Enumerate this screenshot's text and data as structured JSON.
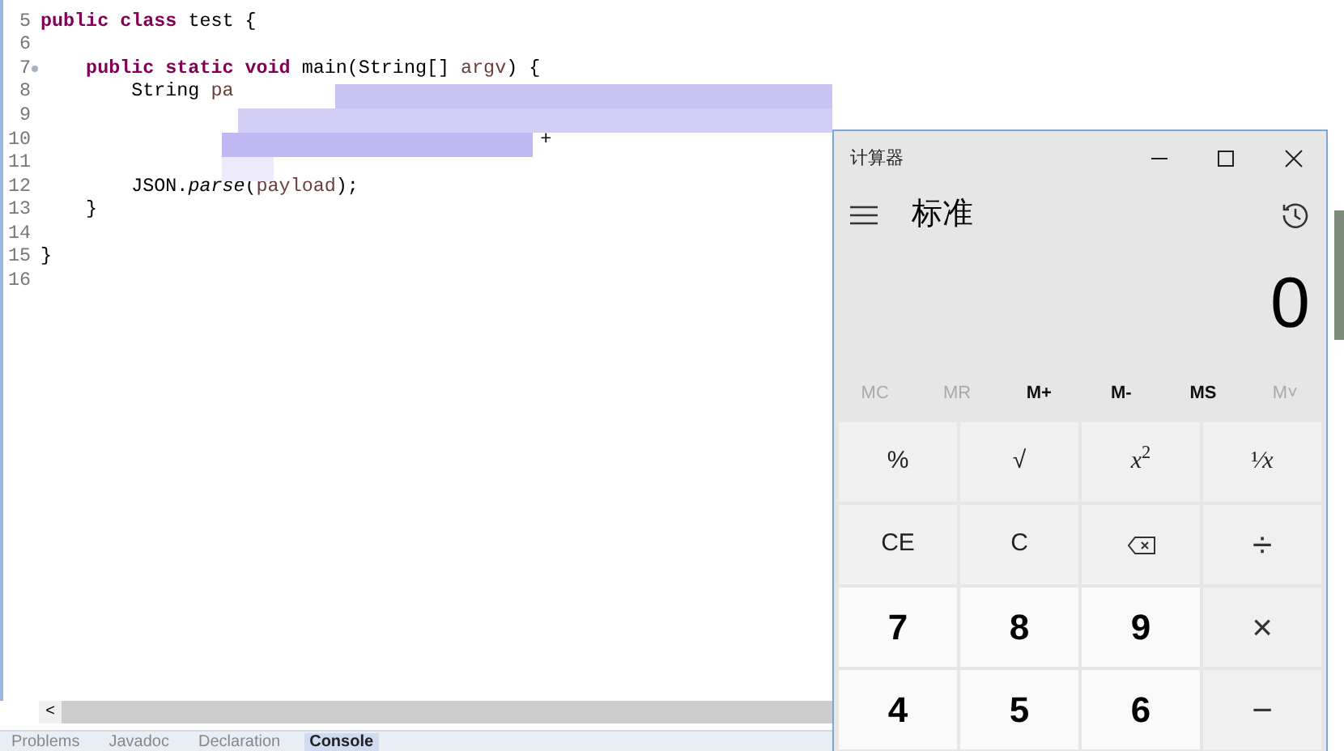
{
  "editor": {
    "lines": [
      {
        "number": "5",
        "tokens": [
          {
            "text": "public class ",
            "kind": "keyword"
          },
          {
            "text": "test {",
            "kind": "plain"
          }
        ]
      },
      {
        "number": "6"
      },
      {
        "number": "7",
        "fold": true,
        "tokens": [
          {
            "text": "    public static void ",
            "kind": "keyword"
          },
          {
            "text": "main(String[] ",
            "kind": "plain"
          },
          {
            "text": "argv",
            "kind": "variable"
          },
          {
            "text": ") {",
            "kind": "plain"
          }
        ]
      },
      {
        "number": "8",
        "redacted": true,
        "tokens": [
          {
            "text": "        String ",
            "kind": "plain"
          },
          {
            "text": "pa",
            "kind": "variable"
          }
        ]
      },
      {
        "number": "9",
        "redacted": true
      },
      {
        "number": "10",
        "redacted": true,
        "tokens": [
          {
            "text": "                                            +",
            "kind": "plain"
          }
        ]
      },
      {
        "number": "11",
        "redacted": true
      },
      {
        "number": "12",
        "tokens": [
          {
            "text": "        JSON.",
            "kind": "plain"
          },
          {
            "text": "parse",
            "kind": "italic"
          },
          {
            "text": "(",
            "kind": "plain"
          },
          {
            "text": "payload",
            "kind": "variable"
          },
          {
            "text": ");",
            "kind": "plain"
          }
        ]
      },
      {
        "number": "13",
        "tokens": [
          {
            "text": "    }",
            "kind": "plain"
          }
        ]
      },
      {
        "number": "14"
      },
      {
        "number": "15",
        "tokens": [
          {
            "text": "}",
            "kind": "plain"
          }
        ]
      },
      {
        "number": "16"
      }
    ],
    "scroll_left": "<"
  },
  "bottom_tabs": [
    {
      "label": "Problems",
      "selected": false
    },
    {
      "label": "Javadoc",
      "selected": false
    },
    {
      "label": "Declaration",
      "selected": false
    },
    {
      "label": "Console",
      "selected": true
    }
  ],
  "calculator": {
    "title": "计算器",
    "mode": "标准",
    "display": "0",
    "memory_buttons": [
      {
        "label": "MC",
        "disabled": true
      },
      {
        "label": "MR",
        "disabled": true
      },
      {
        "label": "M+",
        "disabled": false
      },
      {
        "label": "M-",
        "disabled": false
      },
      {
        "label": "MS",
        "disabled": false
      },
      {
        "label": "M˅",
        "disabled": true
      }
    ],
    "keys": [
      {
        "label": "%",
        "kind": "function"
      },
      {
        "label": "√",
        "kind": "function"
      },
      {
        "label": "*x*$^{2}$",
        "kind": "function"
      },
      {
        "label": "¹⁄*x*",
        "kind": "function"
      },
      {
        "label": "CE",
        "kind": "function"
      },
      {
        "label": "C",
        "kind": "function"
      },
      {
        "kind": "backspace"
      },
      {
        "label": "÷",
        "kind": "operator"
      },
      {
        "label": "7",
        "kind": "digit"
      },
      {
        "label": "8",
        "kind": "digit"
      },
      {
        "label": "9",
        "kind": "digit"
      },
      {
        "label": "×",
        "kind": "operator"
      },
      {
        "label": "4",
        "kind": "digit"
      },
      {
        "label": "5",
        "kind": "digit"
      },
      {
        "label": "6",
        "kind": "digit"
      },
      {
        "label": "−",
        "kind": "operator"
      }
    ]
  }
}
